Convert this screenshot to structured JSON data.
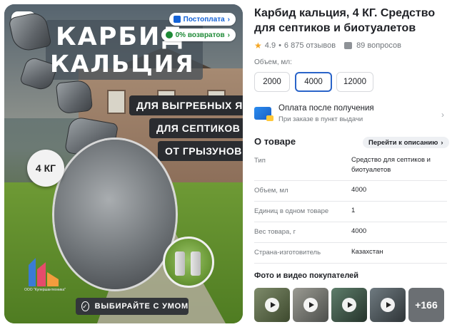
{
  "product_image": {
    "badges": {
      "postpay": "Постоплата",
      "returns": "0% возвратов"
    },
    "headline": [
      "КАРБИД",
      "КАЛЬЦИЯ"
    ],
    "features": [
      "ДЛЯ ВЫГРЕБНЫХ ЯМ",
      "ДЛЯ СЕПТИКОВ",
      "ОТ ГРЫЗУНОВ"
    ],
    "weight_badge": "4 КГ",
    "cta": "ВЫБИРАЙТЕ С УМОМ",
    "brand_caption": "ООО \"Купершантехника\"",
    "icons": {
      "scan": "image-search-icon",
      "check": "check-circle-icon"
    }
  },
  "product": {
    "title": "Карбид кальция, 4 КГ. Средство для септиков и биотуалетов",
    "rating": "4.9",
    "separator": "•",
    "reviews": "6 875 отзывов",
    "questions": "89 вопросов"
  },
  "volume": {
    "label": "Объем, мл:",
    "options": [
      "2000",
      "4000",
      "12000"
    ],
    "selected": "4000"
  },
  "payment": {
    "title": "Оплата после получения",
    "subtitle": "При заказе в пункт выдачи"
  },
  "about": {
    "header": "О товаре",
    "link": "Перейти к описанию",
    "specs": [
      {
        "key": "Тип",
        "value": "Средство для септиков и биотуалетов"
      },
      {
        "key": "Объем, мл",
        "value": "4000"
      },
      {
        "key": "Единиц в одном товаре",
        "value": "1"
      },
      {
        "key": "Вес товара, г",
        "value": "4000"
      },
      {
        "key": "Страна-изготовитель",
        "value": "Казахстан"
      }
    ]
  },
  "customer_media": {
    "header": "Фото и видео покупателей",
    "more_count": "+166"
  },
  "colors": {
    "accent_blue": "#2a64c9",
    "postpay_blue": "#1462d6",
    "returns_green": "#1e8a36",
    "star": "#f5a623"
  }
}
